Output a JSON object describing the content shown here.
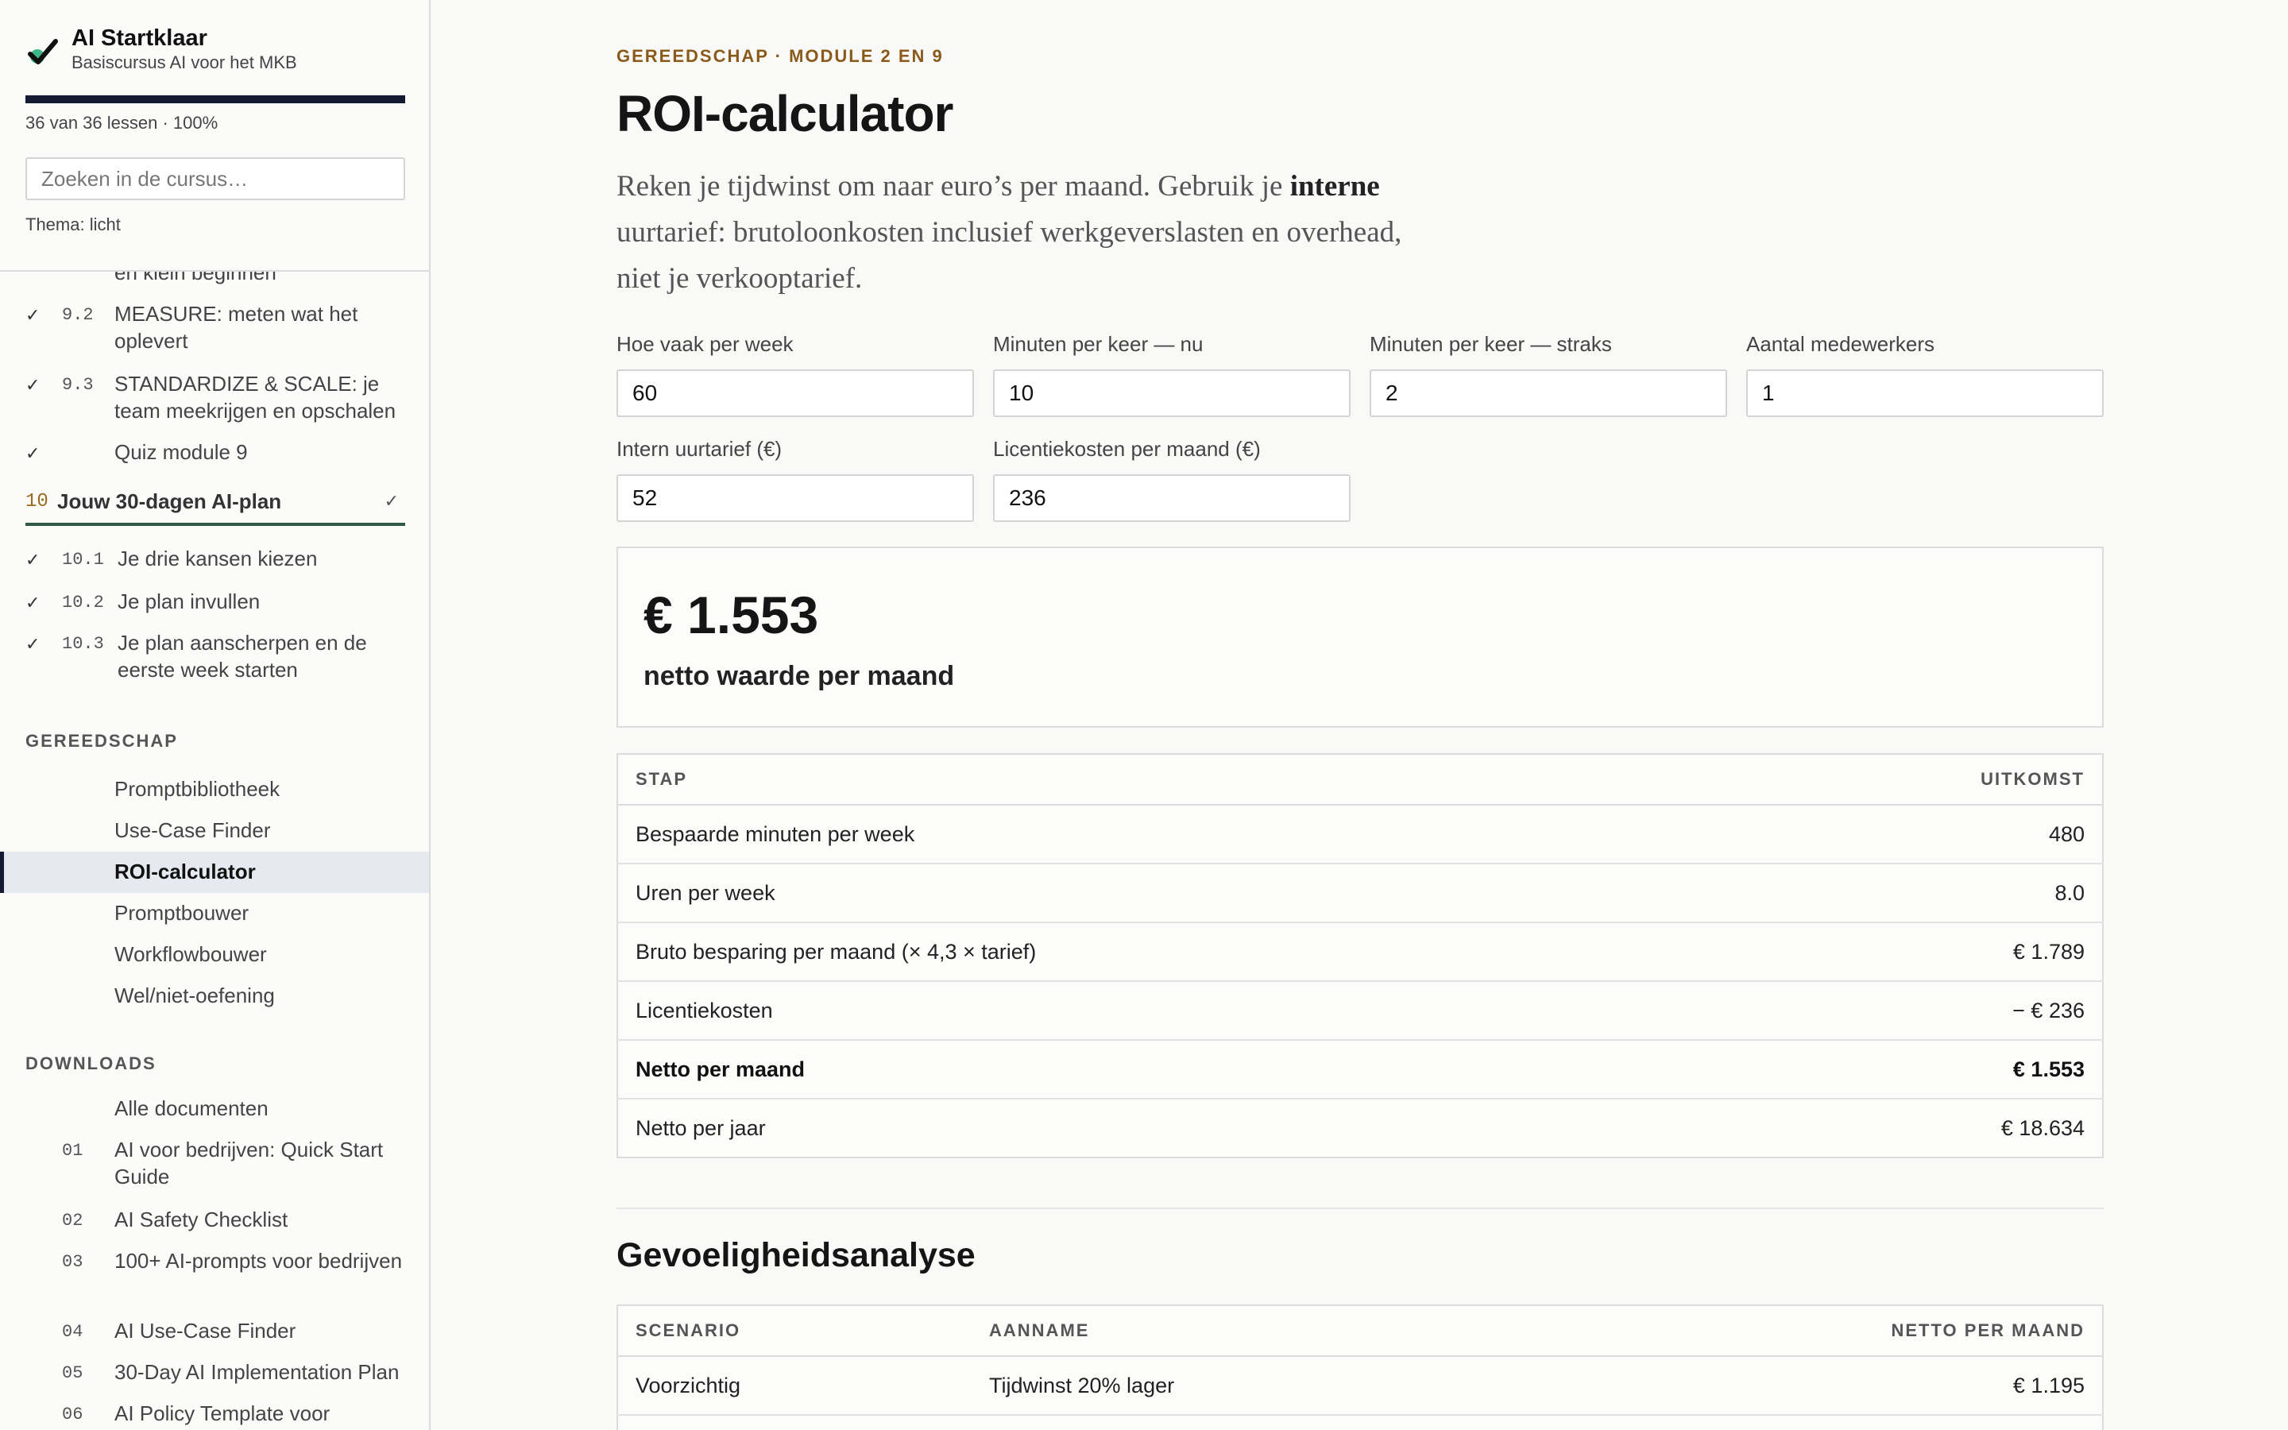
{
  "app": {
    "title": "AI Startklaar",
    "subtitle": "Basiscursus AI voor het MKB",
    "progress_fraction": 1.0,
    "progress_text": "36 van 36 lessen · 100%",
    "search_placeholder": "Zoeken in de cursus…",
    "theme_label": "Thema: licht"
  },
  "sidebar": {
    "partial_item_label": "en klein beginnen",
    "module9_items": [
      {
        "check": "✓",
        "num": "9.2",
        "label": "MEASURE: meten wat het oplevert"
      },
      {
        "check": "✓",
        "num": "9.3",
        "label": "STANDARDIZE & SCALE: je team meekrijgen en opschalen"
      },
      {
        "check": "✓",
        "num": "",
        "label": "Quiz module 9"
      }
    ],
    "module10": {
      "num": "10",
      "title": "Jouw 30-dagen AI-plan",
      "check": "✓"
    },
    "module10_items": [
      {
        "check": "✓",
        "num": "10.1",
        "label": "Je drie kansen kiezen"
      },
      {
        "check": "✓",
        "num": "10.2",
        "label": "Je plan invullen"
      },
      {
        "check": "✓",
        "num": "10.3",
        "label": "Je plan aanscherpen en de eerste week starten"
      }
    ],
    "tools_heading": "GEREEDSCHAP",
    "tools": [
      {
        "label": "Promptbibliotheek"
      },
      {
        "label": "Use-Case Finder"
      },
      {
        "label": "ROI-calculator"
      },
      {
        "label": "Promptbouwer"
      },
      {
        "label": "Workflowbouwer"
      },
      {
        "label": "Wel/niet-oefening"
      }
    ],
    "downloads_heading": "DOWNLOADS",
    "downloads_all": "Alle documenten",
    "downloads": [
      {
        "num": "01",
        "label": "AI voor bedrijven: Quick Start Guide"
      },
      {
        "num": "02",
        "label": "AI Safety Checklist"
      },
      {
        "num": "03",
        "label": "100+ AI-prompts voor bedrijven"
      },
      {
        "num": "04",
        "label": "AI Use-Case Finder"
      },
      {
        "num": "05",
        "label": "30-Day AI Implementation Plan"
      },
      {
        "num": "06",
        "label": "AI Policy Template voor"
      }
    ]
  },
  "main": {
    "eyebrow": "GEREEDSCHAP · MODULE 2 EN 9",
    "title": "ROI-calculator",
    "lead_part1": "Reken je tijdwinst om naar euro’s per maand. Gebruik je ",
    "lead_bold": "interne",
    "lead_part2": " uurtarief: brutoloonkosten inclusief werkgeverslasten en overhead, niet je verkooptarief.",
    "fields": [
      {
        "label": "Hoe vaak per week",
        "value": "60"
      },
      {
        "label": "Minuten per keer — nu",
        "value": "10"
      },
      {
        "label": "Minuten per keer — straks",
        "value": "2"
      },
      {
        "label": "Aantal medewerkers",
        "value": "1"
      },
      {
        "label": "Intern uurtarief (€)",
        "value": "52"
      },
      {
        "label": "Licentiekosten per maand (€)",
        "value": "236"
      }
    ],
    "result": {
      "value": "€ 1.553",
      "label": "netto waarde per maand"
    },
    "calc_table": {
      "headers": [
        "STAP",
        "UITKOMST"
      ],
      "rows": [
        [
          "Bespaarde minuten per week",
          "480"
        ],
        [
          "Uren per week",
          "8.0"
        ],
        [
          "Bruto besparing per maand (× 4,3 × tarief)",
          "€ 1.789"
        ],
        [
          "Licentiekosten",
          "− € 236"
        ],
        [
          "Netto per maand",
          "€ 1.553"
        ],
        [
          "Netto per jaar",
          "€ 18.634"
        ]
      ]
    },
    "sensitivity": {
      "title": "Gevoeligheidsanalyse",
      "headers": [
        "SCENARIO",
        "AANNAME",
        "NETTO PER MAAND"
      ],
      "rows": [
        [
          "Voorzichtig",
          "Tijdwinst 20% lager",
          "€ 1.195"
        ]
      ]
    }
  }
}
